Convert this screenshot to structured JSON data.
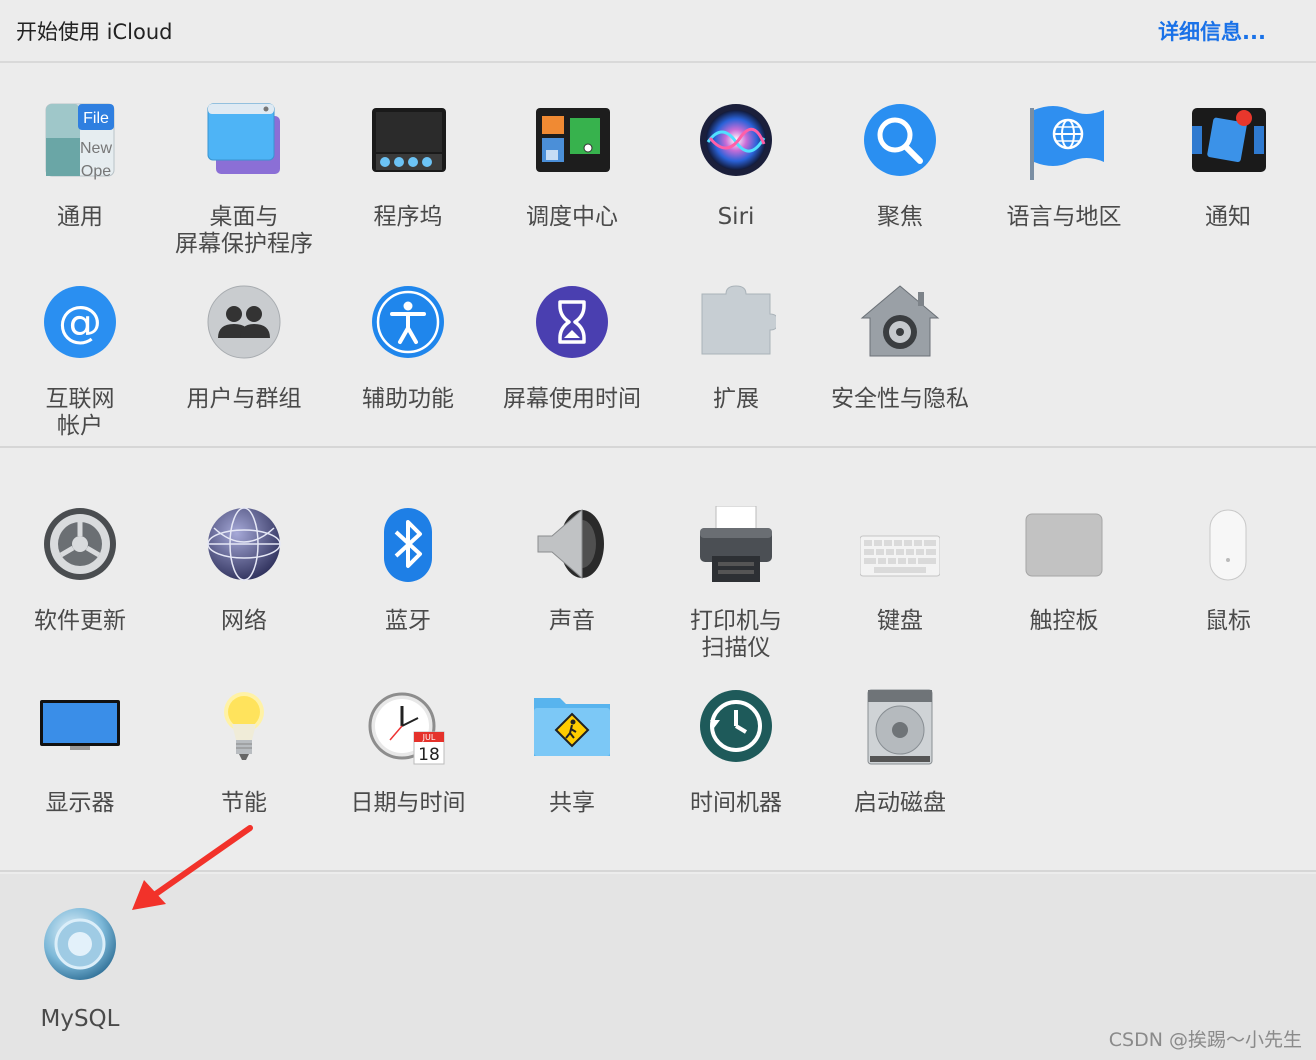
{
  "header": {
    "title": "开始使用 iCloud",
    "details_link": "详细信息..."
  },
  "section1": {
    "items": [
      {
        "label": "通用",
        "icon": "general-icon"
      },
      {
        "label": "桌面与\n屏幕保护程序",
        "icon": "desktop-screensaver-icon"
      },
      {
        "label": "程序坞",
        "icon": "dock-icon"
      },
      {
        "label": "调度中心",
        "icon": "mission-control-icon"
      },
      {
        "label": "Siri",
        "icon": "siri-icon"
      },
      {
        "label": "聚焦",
        "icon": "spotlight-icon"
      },
      {
        "label": "语言与地区",
        "icon": "language-region-icon"
      },
      {
        "label": "通知",
        "icon": "notifications-icon"
      },
      {
        "label": "互联网\n帐户",
        "icon": "internet-accounts-icon"
      },
      {
        "label": "用户与群组",
        "icon": "users-groups-icon"
      },
      {
        "label": "辅助功能",
        "icon": "accessibility-icon"
      },
      {
        "label": "屏幕使用时间",
        "icon": "screen-time-icon"
      },
      {
        "label": "扩展",
        "icon": "extensions-icon"
      },
      {
        "label": "安全性与隐私",
        "icon": "security-privacy-icon"
      }
    ]
  },
  "section2": {
    "items": [
      {
        "label": "软件更新",
        "icon": "software-update-icon"
      },
      {
        "label": "网络",
        "icon": "network-icon"
      },
      {
        "label": "蓝牙",
        "icon": "bluetooth-icon"
      },
      {
        "label": "声音",
        "icon": "sound-icon"
      },
      {
        "label": "打印机与\n扫描仪",
        "icon": "printer-scanner-icon"
      },
      {
        "label": "键盘",
        "icon": "keyboard-icon"
      },
      {
        "label": "触控板",
        "icon": "trackpad-icon"
      },
      {
        "label": "鼠标",
        "icon": "mouse-icon"
      },
      {
        "label": "显示器",
        "icon": "displays-icon"
      },
      {
        "label": "节能",
        "icon": "energy-saver-icon"
      },
      {
        "label": "日期与时间",
        "icon": "date-time-icon"
      },
      {
        "label": "共享",
        "icon": "sharing-icon"
      },
      {
        "label": "时间机器",
        "icon": "time-machine-icon"
      },
      {
        "label": "启动磁盘",
        "icon": "startup-disk-icon"
      }
    ]
  },
  "section3": {
    "items": [
      {
        "label": "MySQL",
        "icon": "mysql-icon"
      }
    ]
  },
  "general_icon_text": {
    "file": "File",
    "new": "New",
    "open": "Ope"
  },
  "calendar_icon_text": {
    "month": "JUL",
    "day": "18"
  },
  "watermark": "CSDN @挨踢～小先生",
  "colors": {
    "link": "#1a72e8",
    "arrow": "#f2322a",
    "background": "#ececec"
  }
}
